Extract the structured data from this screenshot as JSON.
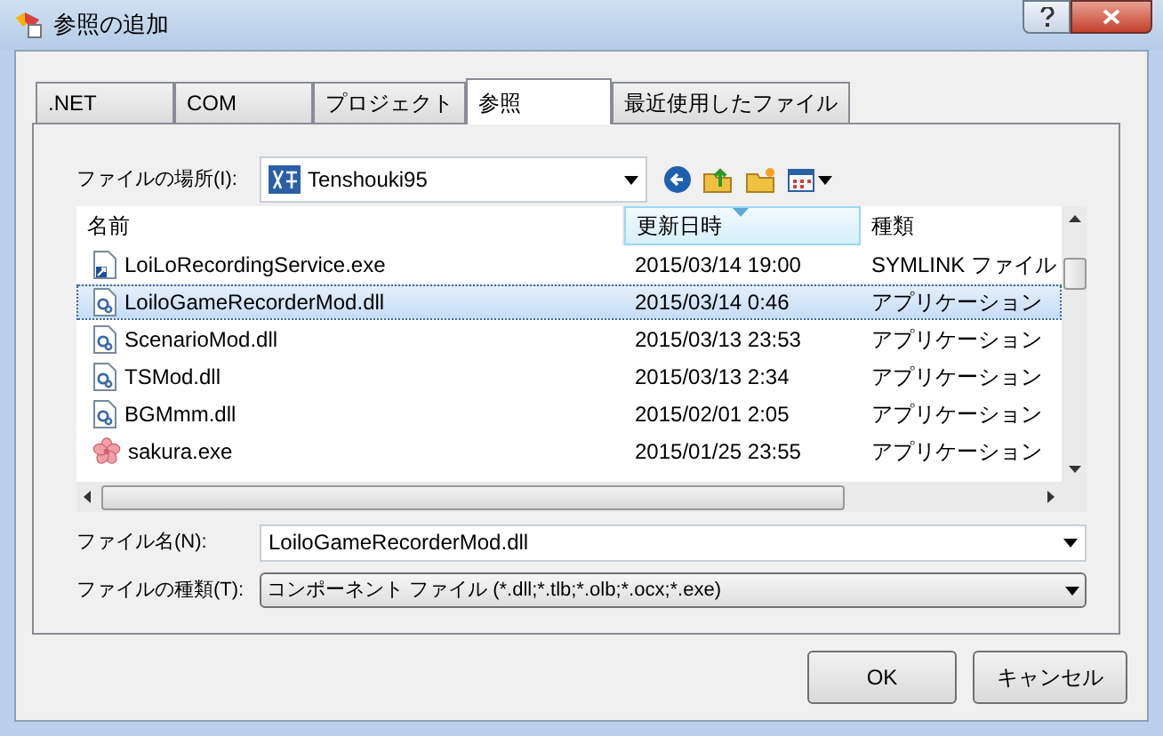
{
  "window": {
    "title": "参照の追加"
  },
  "tabs": [
    {
      "label": ".NET",
      "selected": false
    },
    {
      "label": "COM",
      "selected": false
    },
    {
      "label": "プロジェクト",
      "selected": false
    },
    {
      "label": "参照",
      "selected": true
    },
    {
      "label": "最近使用したファイル",
      "selected": false
    }
  ],
  "location": {
    "label": "ファイルの場所(I):",
    "value": "Tenshouki95"
  },
  "table": {
    "columns": [
      "名前",
      "更新日時",
      "種類"
    ],
    "rows": [
      {
        "kind": "shortcut",
        "name": "LoiLoRecordingService.exe",
        "date": "2015/03/14 19:00",
        "type": "SYMLINK ファイル",
        "selected": false
      },
      {
        "kind": "dll",
        "name": "LoiloGameRecorderMod.dll",
        "date": "2015/03/14 0:46",
        "type": "アプリケーション",
        "selected": true
      },
      {
        "kind": "dll",
        "name": "ScenarioMod.dll",
        "date": "2015/03/13 23:53",
        "type": "アプリケーション",
        "selected": false
      },
      {
        "kind": "dll",
        "name": "TSMod.dll",
        "date": "2015/03/13 2:34",
        "type": "アプリケーション",
        "selected": false
      },
      {
        "kind": "dll",
        "name": "BGMmm.dll",
        "date": "2015/02/01 2:05",
        "type": "アプリケーション",
        "selected": false
      },
      {
        "kind": "flower",
        "name": "sakura.exe",
        "date": "2015/01/25 23:55",
        "type": "アプリケーション",
        "selected": false
      }
    ]
  },
  "file_name": {
    "label": "ファイル名(N):",
    "value": "LoiloGameRecorderMod.dll"
  },
  "file_type": {
    "label": "ファイルの種類(T):",
    "value": "コンポーネント ファイル (*.dll;*.tlb;*.olb;*.ocx;*.exe)"
  },
  "buttons": [
    "OK",
    "キャンセル"
  ]
}
